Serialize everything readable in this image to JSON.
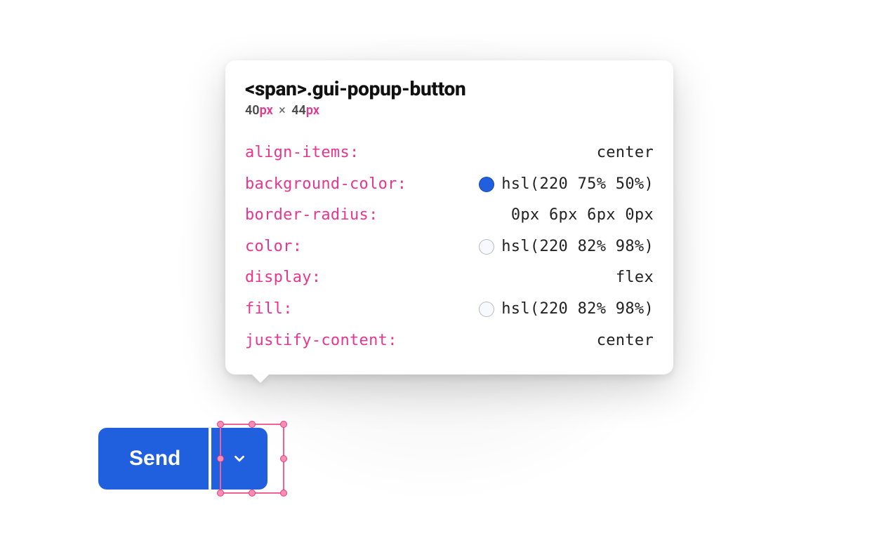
{
  "tooltip": {
    "selector": "<span>.gui-popup-button",
    "dimensions": {
      "width": "40",
      "height": "44",
      "unit": "px"
    },
    "properties": [
      {
        "name": "align-items",
        "value": "center",
        "swatch": null
      },
      {
        "name": "background-color",
        "value": "hsl(220 75% 50%)",
        "swatch": "hsl(220 75% 50%)"
      },
      {
        "name": "border-radius",
        "value": "0px 6px 6px 0px",
        "swatch": null
      },
      {
        "name": "color",
        "value": "hsl(220 82% 98%)",
        "swatch": "hsl(220 82% 98%)"
      },
      {
        "name": "display",
        "value": "flex",
        "swatch": null
      },
      {
        "name": "fill",
        "value": "hsl(220 82% 98%)",
        "swatch": "hsl(220 82% 98%)"
      },
      {
        "name": "justify-content",
        "value": "center",
        "swatch": null
      }
    ]
  },
  "button": {
    "send_label": "Send"
  },
  "colors": {
    "accent_pink": "#e8368f",
    "button_blue": "hsl(220 75% 50%)"
  }
}
